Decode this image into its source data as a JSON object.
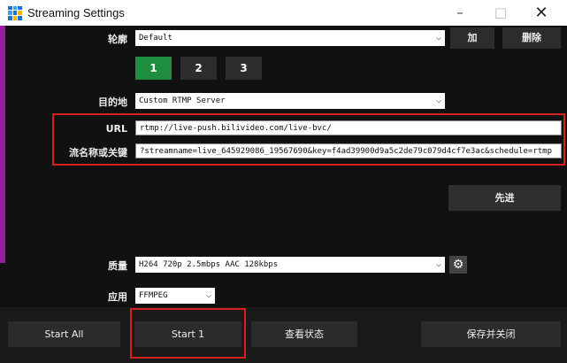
{
  "window": {
    "title": "Streaming Settings",
    "minimize": "–",
    "maximize": "□",
    "close": "✕"
  },
  "profile": {
    "label": "轮廓",
    "value": "Default",
    "add": "加",
    "delete": "删除"
  },
  "tabs": [
    "1",
    "2",
    "3"
  ],
  "destination": {
    "label": "目的地",
    "value": "Custom RTMP Server"
  },
  "url": {
    "label": "URL",
    "value": "rtmp://live-push.bilivideo.com/live-bvc/"
  },
  "stream_key": {
    "label": "流名称或关键",
    "value": "?streamname=live_645929086_19567690&key=f4ad39900d9a5c2de79c079d4cf7e3ac&schedule=rtmp"
  },
  "advanced": "先进",
  "quality": {
    "label": "质量",
    "value": "H264 720p 2.5mbps AAC 128kbps"
  },
  "application": {
    "label": "应用",
    "value": "FFMPEG"
  },
  "bottom": {
    "start_all": "Start All",
    "start_1": "Start 1",
    "view_status": "查看状态",
    "save_close": "保存并关闭"
  }
}
